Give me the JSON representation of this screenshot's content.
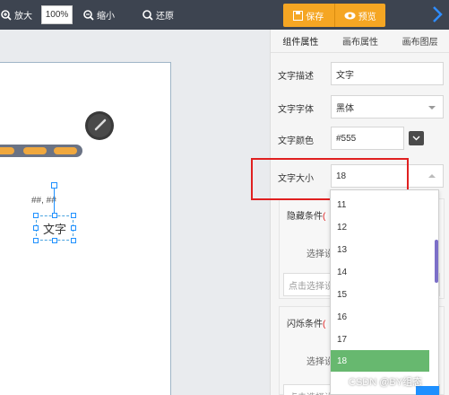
{
  "toolbar": {
    "zoom_in_label": "放大",
    "zoom_value": "100%",
    "zoom_out_label": "缩小",
    "restore_label": "还原",
    "save_label": "保存",
    "preview_label": "预览",
    "accent_color": "#f5a623"
  },
  "canvas": {
    "hash_text": "##, ##",
    "text_widget_label": "文字"
  },
  "panel": {
    "tabs": [
      {
        "label": "组件属性",
        "active": true
      },
      {
        "label": "画布属性",
        "active": false
      },
      {
        "label": "画布图层",
        "active": false
      }
    ],
    "props": {
      "desc_label": "文字描述",
      "desc_value": "文字",
      "font_label": "文字字体",
      "font_value": "黑体",
      "color_label": "文字颜色",
      "color_value": "#555",
      "size_label": "文字大小",
      "size_value": "18"
    },
    "hide_condition": {
      "title": "隐藏条件",
      "req": "(",
      "select_device": "选择设备",
      "click_placeholder": "点击选择设备"
    },
    "blink_condition": {
      "title": "闪烁条件",
      "req": "(",
      "select_device": "选择设备",
      "click_placeholder": "点击选择设备"
    }
  },
  "dropdown": {
    "options": [
      "11",
      "12",
      "13",
      "14",
      "15",
      "16",
      "17",
      "18"
    ],
    "selected": "18"
  },
  "watermark": "CSDN @BY组态"
}
